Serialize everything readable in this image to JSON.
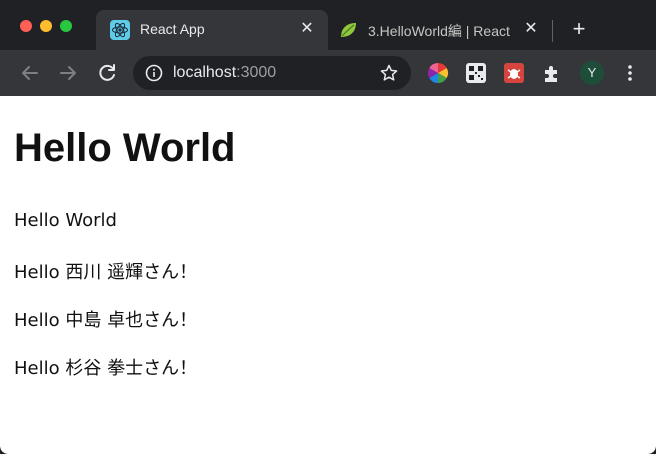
{
  "tabs": [
    {
      "title": "React App",
      "active": true,
      "icon": "react-icon"
    },
    {
      "title": "3.HelloWorld編 | React",
      "active": false,
      "icon": "leaf-icon"
    }
  ],
  "close_glyph": "✕",
  "new_tab_glyph": "+",
  "address": {
    "host": "localhost",
    "port": ":3000"
  },
  "profile_initial": "Y",
  "page": {
    "heading": "Hello World",
    "lines": [
      "Hello World",
      "Hello 西川 遥輝さん！",
      "Hello 中島 卓也さん！",
      "Hello 杉谷 拳士さん！"
    ]
  },
  "colors": {
    "tab_active": "#35363a",
    "toolbar": "#35363a",
    "titlebar": "#202124",
    "page_bg": "#ffffff"
  }
}
